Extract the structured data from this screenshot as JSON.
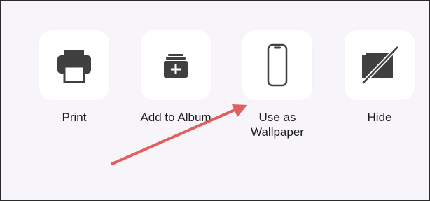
{
  "share_sheet": {
    "actions": [
      {
        "label": "Print",
        "icon": "printer-icon"
      },
      {
        "label": "Add to Album",
        "icon": "add-to-album-icon"
      },
      {
        "label": "Use as\nWallpaper",
        "icon": "phone-icon"
      },
      {
        "label": "Hide",
        "icon": "hide-icon"
      }
    ]
  },
  "colors": {
    "icon": "#404040",
    "tile": "#ffffff",
    "background": "#f7f5f9",
    "annotation_arrow": "#e0605f"
  }
}
